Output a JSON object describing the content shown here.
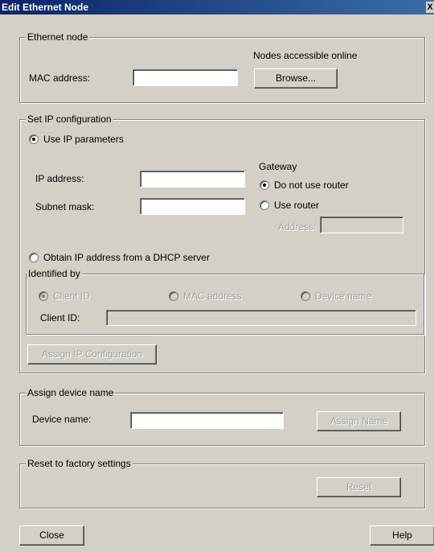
{
  "window": {
    "title": "Edit Ethernet Node",
    "close_glyph": "X"
  },
  "ethernet_node": {
    "legend": "Ethernet node",
    "nodes_online_label": "Nodes accessible online",
    "mac_label": "MAC address:",
    "mac_value": "",
    "browse_button": "Browse..."
  },
  "ip_config": {
    "legend": "Set IP configuration",
    "use_ip_params": "Use IP parameters",
    "ip_address_label": "IP address:",
    "ip_address_value": "",
    "subnet_label": "Subnet mask:",
    "subnet_value": "",
    "gateway_label": "Gateway",
    "no_router": "Do not use router",
    "use_router": "Use router",
    "router_address_label": "Address:",
    "router_address_value": "",
    "dhcp": "Obtain IP address from a DHCP server",
    "identified_by": {
      "legend": "Identified by",
      "client_id_option": "Client ID",
      "mac_option": "MAC address",
      "device_name_option": "Device name",
      "client_id_label": "Client ID:",
      "client_id_value": ""
    },
    "assign_button": "Assign IP Configuration"
  },
  "device_name": {
    "legend": "Assign device name",
    "label": "Device name:",
    "value": "",
    "assign_button": "Assign Name"
  },
  "factory": {
    "legend": "Reset to factory settings",
    "reset_button": "Reset"
  },
  "footer": {
    "close_button": "Close",
    "help_button": "Help"
  }
}
